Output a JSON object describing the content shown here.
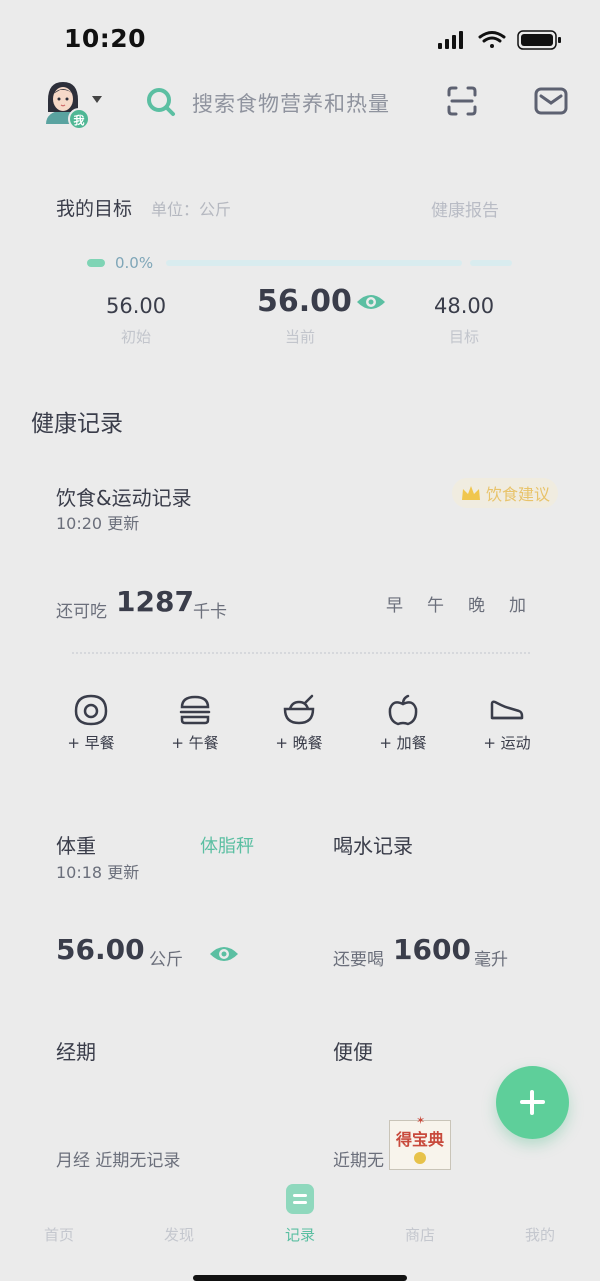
{
  "status_bar": {
    "time": "10:20"
  },
  "header": {
    "avatar_badge": "我",
    "search_placeholder": "搜索食物营养和热量",
    "icons": [
      "search-icon",
      "scan-icon",
      "mail-icon"
    ]
  },
  "goal": {
    "title": "我的目标",
    "unit": "单位：公斤",
    "report_link": "健康报告",
    "progress_pct": "0.0%",
    "progress_fraction": 0.0,
    "start_value": "56.00",
    "start_label": "初始",
    "current_value": "56.00",
    "current_label": "当前",
    "target_value": "48.00",
    "target_label": "目标"
  },
  "health": {
    "section_title": "健康记录",
    "diet": {
      "title": "饮食&运动记录",
      "updated": "10:20 更新",
      "advice_label": "饮食建议",
      "remain_label": "还可吃",
      "remain_value": "1287",
      "remain_unit": "千卡",
      "meal_tabs": [
        "早",
        "午",
        "晚",
        "加"
      ],
      "actions": [
        "+ 早餐",
        "+ 午餐",
        "+ 晚餐",
        "+ 加餐",
        "+ 运动"
      ]
    },
    "weight": {
      "title": "体重",
      "updated": "10:18 更新",
      "scale_link": "体脂秤",
      "value": "56.00",
      "unit": "公斤"
    },
    "water": {
      "title": "喝水记录",
      "remain_label": "还要喝",
      "value": "1600",
      "unit": "毫升"
    },
    "period": {
      "title": "经期",
      "status": "月经 近期无记录"
    },
    "stool": {
      "title": "便便",
      "status": "近期无"
    },
    "sticker_text": "得宝典"
  },
  "tab_bar": {
    "items": [
      "首页",
      "发现",
      "记录",
      "商店",
      "我的"
    ],
    "active": "记录"
  },
  "colors": {
    "accent": "#5bbfa2",
    "fab": "#5ecf9a",
    "gold": "#e8c36a"
  }
}
